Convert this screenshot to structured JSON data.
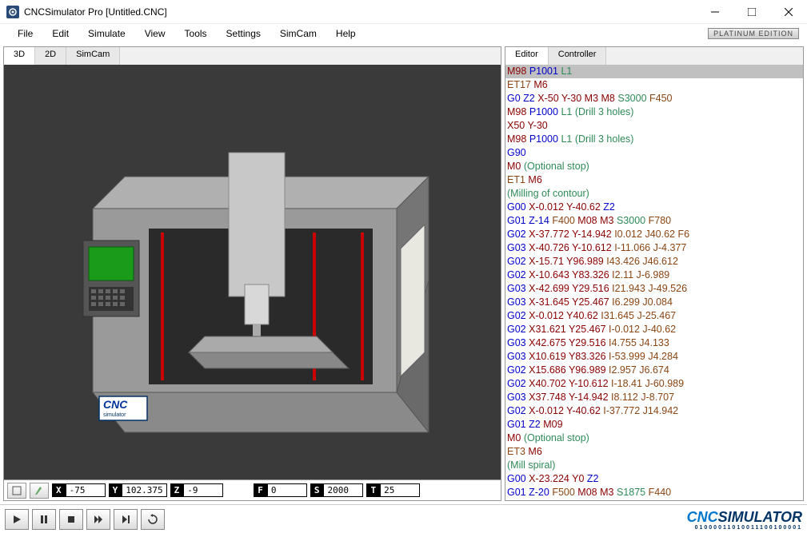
{
  "window": {
    "title": "CNCSimulator Pro [Untitled.CNC]",
    "edition": "PLATINUM EDITION"
  },
  "menu": {
    "items": [
      "File",
      "Edit",
      "Simulate",
      "View",
      "Tools",
      "Settings",
      "SimCam",
      "Help"
    ]
  },
  "view_tabs": {
    "items": [
      "3D",
      "2D",
      "SimCam"
    ],
    "active": "3D"
  },
  "coords": {
    "X": "-75",
    "Y": "102.375",
    "Z": "-9",
    "F": "0",
    "S": "2000",
    "T": "25"
  },
  "editor_tabs": {
    "items": [
      "Editor",
      "Controller"
    ],
    "active": "Editor"
  },
  "code_lines": [
    {
      "hl": true,
      "tokens": [
        [
          "m",
          "M98"
        ],
        [
          " "
        ],
        [
          "p",
          "P1001"
        ],
        [
          " "
        ],
        [
          "l",
          "L1"
        ]
      ]
    },
    {
      "tokens": [
        [
          "e",
          "ET17"
        ],
        [
          " "
        ],
        [
          "m",
          "M6"
        ]
      ]
    },
    {
      "tokens": [
        [
          "g",
          "G0"
        ],
        [
          " "
        ],
        [
          "z",
          "Z2"
        ],
        [
          " "
        ],
        [
          "x",
          "X-50"
        ],
        [
          " "
        ],
        [
          "y",
          "Y-30"
        ],
        [
          " "
        ],
        [
          "m",
          "M3"
        ],
        [
          " "
        ],
        [
          "m",
          "M8"
        ],
        [
          " "
        ],
        [
          "s",
          "S3000"
        ],
        [
          " "
        ],
        [
          "f",
          "F450"
        ]
      ]
    },
    {
      "tokens": [
        [
          "m",
          "M98"
        ],
        [
          " "
        ],
        [
          "p",
          "P1000"
        ],
        [
          " "
        ],
        [
          "l",
          "L1"
        ],
        [
          " "
        ],
        [
          "c",
          "(Drill 3 holes)"
        ]
      ]
    },
    {
      "tokens": [
        [
          "x",
          "X50"
        ],
        [
          " "
        ],
        [
          "y",
          "Y-30"
        ]
      ]
    },
    {
      "tokens": [
        [
          "m",
          "M98"
        ],
        [
          " "
        ],
        [
          "p",
          "P1000"
        ],
        [
          " "
        ],
        [
          "l",
          "L1"
        ],
        [
          " "
        ],
        [
          "c",
          "(Drill 3 holes)"
        ]
      ]
    },
    {
      "tokens": [
        [
          "g",
          "G90"
        ]
      ]
    },
    {
      "tokens": [
        [
          "m",
          "M0"
        ],
        [
          " "
        ],
        [
          "c",
          "(Optional stop)"
        ]
      ]
    },
    {
      "tokens": [
        [
          "e",
          "ET1"
        ],
        [
          " "
        ],
        [
          "m",
          "M6"
        ]
      ]
    },
    {
      "tokens": [
        [
          "c",
          "(Milling of contour)"
        ]
      ]
    },
    {
      "tokens": [
        [
          "g",
          "G00"
        ],
        [
          " "
        ],
        [
          "x",
          "X-0.012"
        ],
        [
          " "
        ],
        [
          "y",
          "Y-40.62"
        ],
        [
          " "
        ],
        [
          "z",
          "Z2"
        ]
      ]
    },
    {
      "tokens": [
        [
          "g",
          "G01"
        ],
        [
          " "
        ],
        [
          "z",
          "Z-14"
        ],
        [
          " "
        ],
        [
          "f",
          "F400"
        ],
        [
          " "
        ],
        [
          "m",
          "M08"
        ],
        [
          " "
        ],
        [
          "m",
          "M3"
        ],
        [
          " "
        ],
        [
          "s",
          "S3000"
        ],
        [
          " "
        ],
        [
          "f",
          "F780"
        ]
      ]
    },
    {
      "tokens": [
        [
          "g",
          "G02"
        ],
        [
          " "
        ],
        [
          "x",
          "X-37.772"
        ],
        [
          " "
        ],
        [
          "y",
          "Y-14.942"
        ],
        [
          " "
        ],
        [
          "i",
          "I0.012"
        ],
        [
          " "
        ],
        [
          "j",
          "J40.62"
        ],
        [
          " "
        ],
        [
          "f",
          "F6"
        ]
      ]
    },
    {
      "tokens": [
        [
          "g",
          "G03"
        ],
        [
          " "
        ],
        [
          "x",
          "X-40.726"
        ],
        [
          " "
        ],
        [
          "y",
          "Y-10.612"
        ],
        [
          " "
        ],
        [
          "i",
          "I-11.066"
        ],
        [
          " "
        ],
        [
          "j",
          "J-4.377"
        ]
      ]
    },
    {
      "tokens": [
        [
          "g",
          "G02"
        ],
        [
          " "
        ],
        [
          "x",
          "X-15.71"
        ],
        [
          " "
        ],
        [
          "y",
          "Y96.989"
        ],
        [
          " "
        ],
        [
          "i",
          "I43.426"
        ],
        [
          " "
        ],
        [
          "j",
          "J46.612"
        ]
      ]
    },
    {
      "tokens": [
        [
          "g",
          "G02"
        ],
        [
          " "
        ],
        [
          "x",
          "X-10.643"
        ],
        [
          " "
        ],
        [
          "y",
          "Y83.326"
        ],
        [
          " "
        ],
        [
          "i",
          "I2.11"
        ],
        [
          " "
        ],
        [
          "j",
          "J-6.989"
        ]
      ]
    },
    {
      "tokens": [
        [
          "g",
          "G03"
        ],
        [
          " "
        ],
        [
          "x",
          "X-42.699"
        ],
        [
          " "
        ],
        [
          "y",
          "Y29.516"
        ],
        [
          " "
        ],
        [
          "i",
          "I21.943"
        ],
        [
          " "
        ],
        [
          "j",
          "J-49.526"
        ]
      ]
    },
    {
      "tokens": [
        [
          "g",
          "G03"
        ],
        [
          " "
        ],
        [
          "x",
          "X-31.645"
        ],
        [
          " "
        ],
        [
          "y",
          "Y25.467"
        ],
        [
          " "
        ],
        [
          "i",
          "I6.299"
        ],
        [
          " "
        ],
        [
          "j",
          "J0.084"
        ]
      ]
    },
    {
      "tokens": [
        [
          "g",
          "G02"
        ],
        [
          " "
        ],
        [
          "x",
          "X-0.012"
        ],
        [
          " "
        ],
        [
          "y",
          "Y40.62"
        ],
        [
          " "
        ],
        [
          "i",
          "I31.645"
        ],
        [
          " "
        ],
        [
          "j",
          "J-25.467"
        ]
      ]
    },
    {
      "tokens": [
        [
          "g",
          "G02"
        ],
        [
          " "
        ],
        [
          "x",
          "X31.621"
        ],
        [
          " "
        ],
        [
          "y",
          "Y25.467"
        ],
        [
          " "
        ],
        [
          "i",
          "I-0.012"
        ],
        [
          " "
        ],
        [
          "j",
          "J-40.62"
        ]
      ]
    },
    {
      "tokens": [
        [
          "g",
          "G03"
        ],
        [
          " "
        ],
        [
          "x",
          "X42.675"
        ],
        [
          " "
        ],
        [
          "y",
          "Y29.516"
        ],
        [
          " "
        ],
        [
          "i",
          "I4.755"
        ],
        [
          " "
        ],
        [
          "j",
          "J4.133"
        ]
      ]
    },
    {
      "tokens": [
        [
          "g",
          "G03"
        ],
        [
          " "
        ],
        [
          "x",
          "X10.619"
        ],
        [
          " "
        ],
        [
          "y",
          "Y83.326"
        ],
        [
          " "
        ],
        [
          "i",
          "I-53.999"
        ],
        [
          " "
        ],
        [
          "j",
          "J4.284"
        ]
      ]
    },
    {
      "tokens": [
        [
          "g",
          "G02"
        ],
        [
          " "
        ],
        [
          "x",
          "X15.686"
        ],
        [
          " "
        ],
        [
          "y",
          "Y96.989"
        ],
        [
          " "
        ],
        [
          "i",
          "I2.957"
        ],
        [
          " "
        ],
        [
          "j",
          "J6.674"
        ]
      ]
    },
    {
      "tokens": [
        [
          "g",
          "G02"
        ],
        [
          " "
        ],
        [
          "x",
          "X40.702"
        ],
        [
          " "
        ],
        [
          "y",
          "Y-10.612"
        ],
        [
          " "
        ],
        [
          "i",
          "I-18.41"
        ],
        [
          " "
        ],
        [
          "j",
          "J-60.989"
        ]
      ]
    },
    {
      "tokens": [
        [
          "g",
          "G03"
        ],
        [
          " "
        ],
        [
          "x",
          "X37.748"
        ],
        [
          " "
        ],
        [
          "y",
          "Y-14.942"
        ],
        [
          " "
        ],
        [
          "i",
          "I8.112"
        ],
        [
          " "
        ],
        [
          "j",
          "J-8.707"
        ]
      ]
    },
    {
      "tokens": [
        [
          "g",
          "G02"
        ],
        [
          " "
        ],
        [
          "x",
          "X-0.012"
        ],
        [
          " "
        ],
        [
          "y",
          "Y-40.62"
        ],
        [
          " "
        ],
        [
          "i",
          "I-37.772"
        ],
        [
          " "
        ],
        [
          "j",
          "J14.942"
        ]
      ]
    },
    {
      "tokens": [
        [
          "g",
          "G01"
        ],
        [
          " "
        ],
        [
          "z",
          "Z2"
        ],
        [
          " "
        ],
        [
          "m",
          "M09"
        ]
      ]
    },
    {
      "tokens": [
        [
          "m",
          "M0"
        ],
        [
          " "
        ],
        [
          "c",
          "(Optional stop)"
        ]
      ]
    },
    {
      "tokens": [
        [
          "e",
          "ET3"
        ],
        [
          " "
        ],
        [
          "m",
          "M6"
        ]
      ]
    },
    {
      "tokens": [
        [
          "c",
          "(Mill spiral)"
        ]
      ]
    },
    {
      "tokens": [
        [
          "g",
          "G00"
        ],
        [
          " "
        ],
        [
          "x",
          "X-23.224"
        ],
        [
          " "
        ],
        [
          "y",
          "Y0"
        ],
        [
          " "
        ],
        [
          "z",
          "Z2"
        ]
      ]
    },
    {
      "tokens": [
        [
          "g",
          "G01"
        ],
        [
          " "
        ],
        [
          "z",
          "Z-20"
        ],
        [
          " "
        ],
        [
          "f",
          "F500"
        ],
        [
          " "
        ],
        [
          "m",
          "M08"
        ],
        [
          " "
        ],
        [
          "m",
          "M3"
        ],
        [
          " "
        ],
        [
          "s",
          "S1875"
        ],
        [
          " "
        ],
        [
          "f",
          "F440"
        ]
      ]
    }
  ],
  "footer_logo": {
    "text": "CNCSIMULATOR",
    "sub": "01000011010011100100001"
  }
}
